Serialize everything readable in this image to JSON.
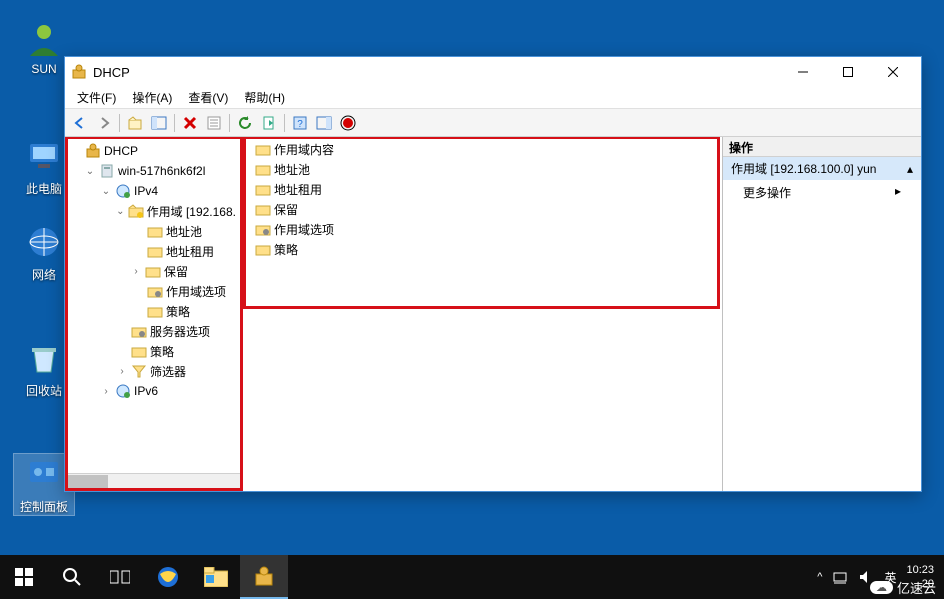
{
  "desktop": {
    "icons": [
      {
        "label": "SUN"
      },
      {
        "label": "此电脑"
      },
      {
        "label": "网络"
      },
      {
        "label": "回收站"
      },
      {
        "label": "控制面板"
      }
    ]
  },
  "window": {
    "title": "DHCP",
    "menu": {
      "file": "文件(F)",
      "action": "操作(A)",
      "view": "查看(V)",
      "help": "帮助(H)"
    },
    "tree": {
      "root": "DHCP",
      "server": "win-517h6nk6f2l",
      "ipv4": "IPv4",
      "scope": "作用域 [192.168.",
      "pool": "地址池",
      "lease": "地址租用",
      "reserve": "保留",
      "scope_opts": "作用域选项",
      "policy": "策略",
      "server_opts": "服务器选项",
      "policy2": "策略",
      "filter": "筛选器",
      "ipv6": "IPv6"
    },
    "list": {
      "scope_content": "作用域内容",
      "pool": "地址池",
      "lease": "地址租用",
      "reserve": "保留",
      "scope_opts": "作用域选项",
      "policy": "策略"
    },
    "actions": {
      "header": "操作",
      "scope_title": "作用域 [192.168.100.0] yun",
      "more": "更多操作"
    }
  },
  "taskbar": {
    "lang": "英",
    "time": "10:23",
    "date": "20"
  },
  "watermark": "亿速云"
}
